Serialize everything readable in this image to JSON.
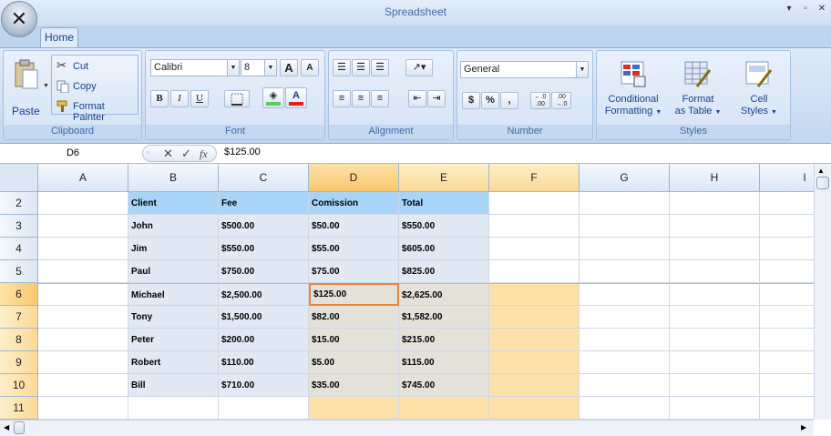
{
  "window": {
    "title": "Spreadsheet",
    "minimize": "▾",
    "restore": "▫",
    "close": "✕"
  },
  "tabs": [
    {
      "label": "Home",
      "active": true
    }
  ],
  "clipboard": {
    "group_label": "Clipboard",
    "paste": "Paste",
    "cut": "Cut",
    "copy": "Copy",
    "format_painter": "Format Painter"
  },
  "font": {
    "group_label": "Font",
    "family": "Calibri",
    "size": "8",
    "bold": "B",
    "italic": "I",
    "underline": "U",
    "grow": "A",
    "shrink": "A"
  },
  "alignment": {
    "group_label": "Alignment"
  },
  "number": {
    "group_label": "Number",
    "format": "General",
    "currency": "$",
    "percent": "%",
    "comma": ",",
    "inc_decimal": "←.0 .00",
    "dec_decimal": ".00 →.0"
  },
  "styles": {
    "group_label": "Styles",
    "conditional_line1": "Conditional",
    "conditional_line2": "Formatting",
    "table_line1": "Format",
    "table_line2": "as Table",
    "cell_line1": "Cell",
    "cell_line2": "Styles"
  },
  "formula_bar": {
    "name_box": "D6",
    "value": "$125.00",
    "cancel": "✕",
    "enter": "✓",
    "fx": "fx"
  },
  "columns": [
    "A",
    "B",
    "C",
    "D",
    "E",
    "F",
    "G",
    "H",
    "I"
  ],
  "selected_column": "D",
  "rows": [
    {
      "num": "2",
      "cells": [
        "",
        "Client",
        "Fee",
        "Comission",
        "Total",
        "",
        "",
        "",
        ""
      ]
    },
    {
      "num": "3",
      "cells": [
        "",
        "John",
        "$500.00",
        "$50.00",
        "$550.00",
        "",
        "",
        "",
        ""
      ]
    },
    {
      "num": "4",
      "cells": [
        "",
        "Jim",
        "$550.00",
        "$55.00",
        "$605.00",
        "",
        "",
        "",
        ""
      ]
    },
    {
      "num": "5",
      "cells": [
        "",
        "Paul",
        "$750.00",
        "$75.00",
        "$825.00",
        "",
        "",
        "",
        ""
      ]
    },
    {
      "num": "6",
      "cells": [
        "",
        "Michael",
        "$2,500.00",
        "$125.00",
        "$2,625.00",
        "",
        "",
        "",
        ""
      ]
    },
    {
      "num": "7",
      "cells": [
        "",
        "Tony",
        "$1,500.00",
        "$82.00",
        "$1,582.00",
        "",
        "",
        "",
        ""
      ]
    },
    {
      "num": "8",
      "cells": [
        "",
        "Peter",
        "$200.00",
        "$15.00",
        "$215.00",
        "",
        "",
        "",
        ""
      ]
    },
    {
      "num": "9",
      "cells": [
        "",
        "Robert",
        "$110.00",
        "$5.00",
        "$115.00",
        "",
        "",
        "",
        ""
      ]
    },
    {
      "num": "10",
      "cells": [
        "",
        "Bill",
        "$710.00",
        "$35.00",
        "$745.00",
        "",
        "",
        "",
        ""
      ]
    },
    {
      "num": "11",
      "cells": [
        "",
        "",
        "",
        "",
        "",
        "",
        "",
        "",
        ""
      ]
    }
  ],
  "colors": {
    "header_fill": "#a8d4f7",
    "data_fill": "#e1e9f4",
    "selection_fill": "#e3e1d8",
    "highlight_fill": "#fde1a8",
    "active_border": "#e7863c"
  }
}
